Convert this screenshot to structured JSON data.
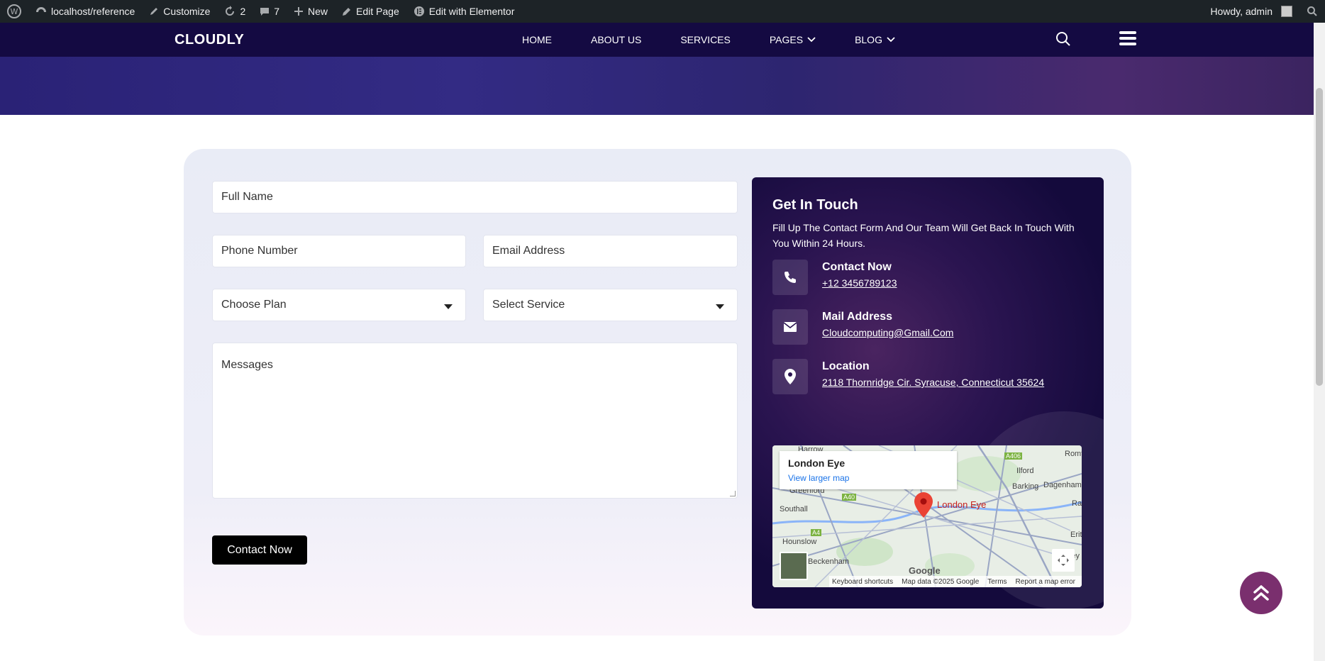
{
  "adminbar": {
    "site": "localhost/reference",
    "customize": "Customize",
    "updates": "2",
    "comments": "7",
    "new": "New",
    "edit_page": "Edit Page",
    "elementor": "Edit with Elementor",
    "howdy": "Howdy, admin"
  },
  "header": {
    "logo": "CLOUDLY",
    "nav": [
      "HOME",
      "ABOUT US",
      "SERVICES",
      "PAGES",
      "BLOG"
    ]
  },
  "form": {
    "full_name": "Full Name",
    "phone": "Phone Number",
    "email": "Email Address",
    "plan": "Choose Plan",
    "service": "Select Service",
    "messages": "Messages",
    "submit": "Contact Now"
  },
  "info": {
    "title": "Get In Touch",
    "desc": "Fill Up The Contact Form And Our Team Will Get Back In Touch With You Within 24 Hours.",
    "contact_label": "Contact Now",
    "contact_value": "+12 3456789123",
    "mail_label": "Mail Address",
    "mail_value": "Cloudcomputing@Gmail.Com",
    "location_label": "Location",
    "location_value": "2118 Thornridge Cir. Syracuse, Connecticut 35624"
  },
  "map": {
    "place": "London Eye",
    "larger": "View larger map",
    "pin_label": "London Eye",
    "labels": [
      "Harrow",
      "Greenford",
      "Southall",
      "Hounslow",
      "Beckenham",
      "Ilford",
      "Barking",
      "Dagenham",
      "Romford",
      "Erith",
      "Bexley",
      "Rainham",
      "A406",
      "A40",
      "A4"
    ],
    "footer": [
      "Keyboard shortcuts",
      "Map data ©2025 Google",
      "Terms",
      "Report a map error"
    ],
    "logo": "Google"
  },
  "colors": {
    "header": "#140a42",
    "accent": "#7a2f6e",
    "button": "#000000"
  }
}
